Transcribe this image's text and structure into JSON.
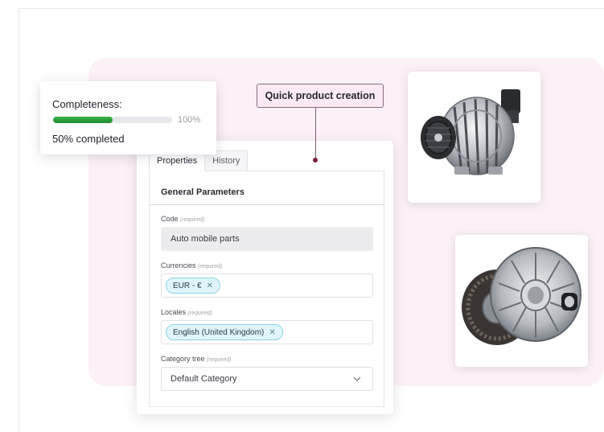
{
  "completeness": {
    "title": "Completeness:",
    "progress_fraction": 0.5,
    "max_label": "100%",
    "status": "50% completed"
  },
  "callout": {
    "label": "Quick product creation"
  },
  "form": {
    "tabs": [
      {
        "label": "Properties",
        "active": true
      },
      {
        "label": "History",
        "active": false
      }
    ],
    "section_title": "General Parameters",
    "fields": {
      "code": {
        "label": "Code",
        "required": "(required)",
        "value": "Auto mobile parts"
      },
      "currencies": {
        "label": "Currencies",
        "required": "(required)",
        "chip": "EUR - €"
      },
      "locales": {
        "label": "Locales",
        "required": "(required)",
        "chip": "English (United Kingdom)"
      },
      "category_tree": {
        "label": "Category tree",
        "required": "(required)",
        "value": "Default Category"
      }
    },
    "chip_remove_icon": "close-icon",
    "select_icon": "chevron-down-icon"
  },
  "images": [
    {
      "name": "alternator-image"
    },
    {
      "name": "clutch-kit-image"
    }
  ],
  "colors": {
    "accent_green": "#2ea33d",
    "chip_bg": "#dff5fb",
    "callout_bg": "#fbeaf3",
    "background_tint": "#fcf1f7"
  }
}
